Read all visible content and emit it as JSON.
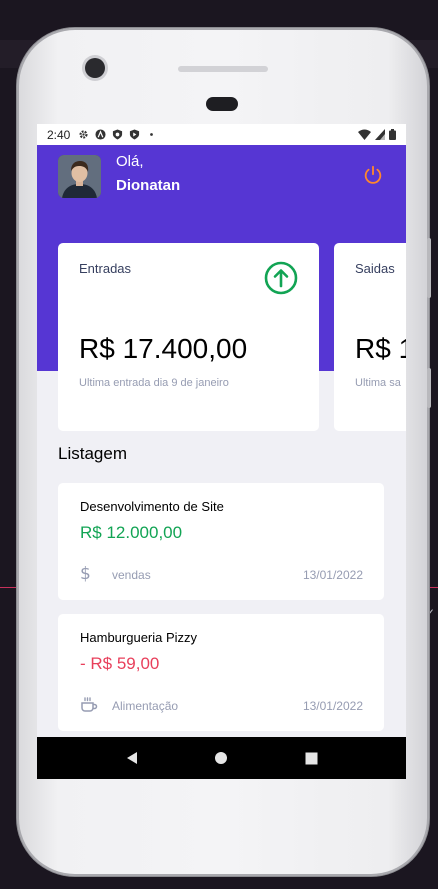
{
  "status_bar": {
    "time": "2:40"
  },
  "header": {
    "greeting": "Olá,",
    "user_name": "Dionatan"
  },
  "highlight_cards": [
    {
      "title": "Entradas",
      "amount": "R$ 17.400,00",
      "subtitle": "Ultima entrada dia 9 de janeiro",
      "icon": "arrow-up-circle-icon",
      "icon_color": "#12a454"
    },
    {
      "title": "Saidas",
      "amount": "R$ 1",
      "subtitle": "Ultima sa"
    }
  ],
  "listing": {
    "title": "Listagem",
    "transactions": [
      {
        "name": "Desenvolvimento de Site",
        "amount": "R$ 12.000,00",
        "type": "income",
        "color": "#12a454",
        "category": "vendas",
        "category_icon": "dollar-icon",
        "date": "13/01/2022"
      },
      {
        "name": "Hamburgueria Pizzy",
        "amount": "- R$ 59,00",
        "type": "outcome",
        "color": "#e83f5b",
        "category": "Alimentação",
        "category_icon": "coffee-icon",
        "date": "13/01/2022"
      }
    ]
  },
  "colors": {
    "primary": "#5636d3",
    "background": "#f0f0f5",
    "text_light": "#969cb2",
    "power": "#ff872c"
  }
}
